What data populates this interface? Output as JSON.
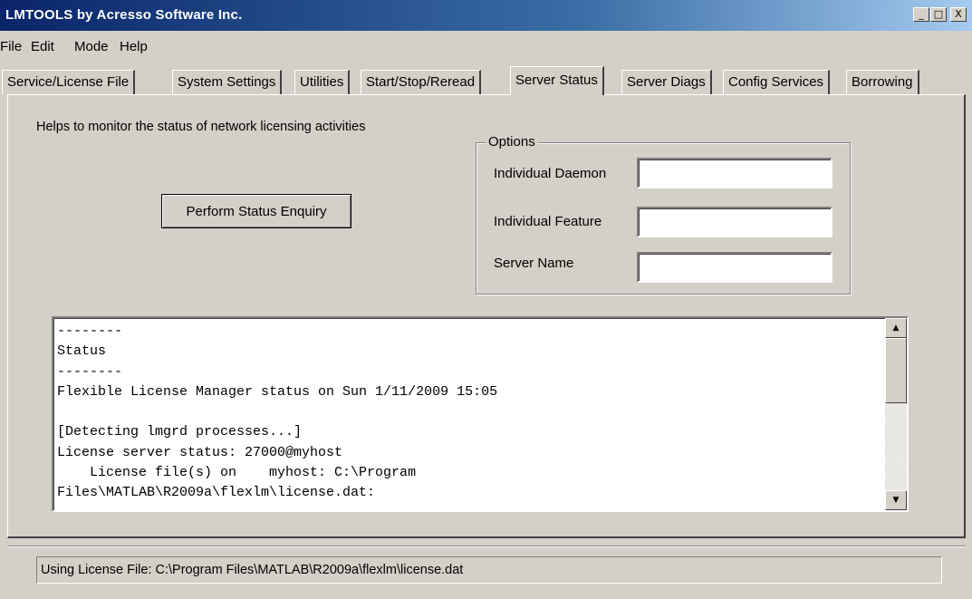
{
  "window": {
    "title": "LMTOOLS by Acresso Software Inc.",
    "controls": {
      "minimize": "_",
      "maximize": "□",
      "close": "X"
    }
  },
  "menu": [
    "File",
    "Edit",
    "Mode",
    "Help"
  ],
  "tabs": [
    {
      "label": "Service/License File",
      "active": false
    },
    {
      "label": "System Settings",
      "active": false
    },
    {
      "label": "Utilities",
      "active": false
    },
    {
      "label": "Start/Stop/Reread",
      "active": false
    },
    {
      "label": "Server Status",
      "active": true
    },
    {
      "label": "Server Diags",
      "active": false
    },
    {
      "label": "Config Services",
      "active": false
    },
    {
      "label": "Borrowing",
      "active": false
    }
  ],
  "panel": {
    "description": "Helps to monitor the status of network licensing activities",
    "perform_button": "Perform Status Enquiry",
    "options": {
      "legend": "Options",
      "daemon_label": "Individual Daemon",
      "daemon_value": "",
      "feature_label": "Individual Feature",
      "feature_value": "",
      "server_label": "Server Name",
      "server_value": ""
    },
    "output_text": "--------\nStatus\n--------\nFlexible License Manager status on Sun 1/11/2009 15:05\n\n[Detecting lmgrd processes...]\nLicense server status: 27000@myhost\n    License file(s) on    myhost: C:\\Program\nFiles\\MATLAB\\R2009a\\flexlm\\license.dat:",
    "scrollbar": {
      "up_arrow": "▲",
      "down_arrow": "▼"
    }
  },
  "status_bar": {
    "text": "Using License File:  C:\\Program Files\\MATLAB\\R2009a\\flexlm\\license.dat"
  }
}
